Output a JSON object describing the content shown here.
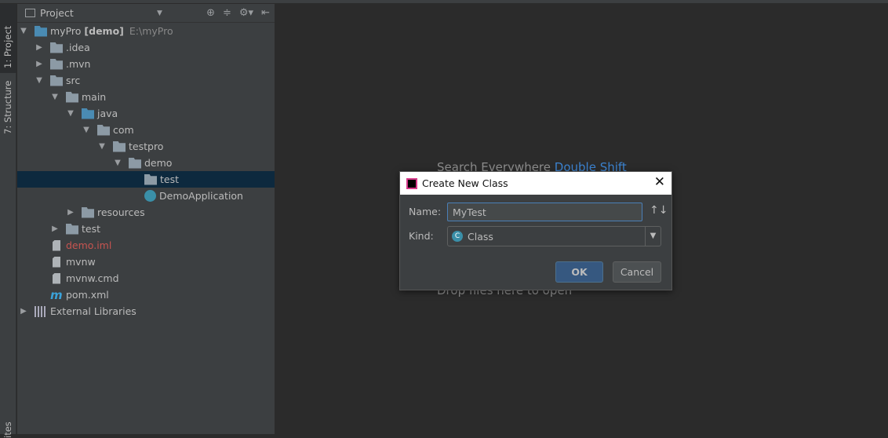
{
  "sidebar": {
    "tabs": [
      {
        "label": "1: Project"
      },
      {
        "label": "7: Structure"
      },
      {
        "label": "ites"
      }
    ]
  },
  "project_panel": {
    "title": "Project",
    "header_icons": [
      "locate-icon",
      "collapse-all-icon",
      "gear-icon",
      "hide-icon"
    ],
    "tree": [
      {
        "label": "myPro",
        "module": "[demo]",
        "path": "E:\\myPro",
        "level": 0,
        "expanded": true,
        "icon": "module-folder"
      },
      {
        "label": ".idea",
        "level": 1,
        "expanded": false,
        "icon": "folder"
      },
      {
        "label": ".mvn",
        "level": 1,
        "expanded": false,
        "icon": "folder"
      },
      {
        "label": "src",
        "level": 1,
        "expanded": true,
        "icon": "folder"
      },
      {
        "label": "main",
        "level": 2,
        "expanded": true,
        "icon": "folder"
      },
      {
        "label": "java",
        "level": 3,
        "expanded": true,
        "icon": "source-folder"
      },
      {
        "label": "com",
        "level": 4,
        "expanded": true,
        "icon": "package"
      },
      {
        "label": "testpro",
        "level": 5,
        "expanded": true,
        "icon": "package"
      },
      {
        "label": "demo",
        "level": 6,
        "expanded": true,
        "icon": "package"
      },
      {
        "label": "test",
        "level": 7,
        "icon": "package",
        "selected": true
      },
      {
        "label": "DemoApplication",
        "level": 7,
        "icon": "spring-class"
      },
      {
        "label": "resources",
        "level": 3,
        "expanded": false,
        "icon": "resources-folder"
      },
      {
        "label": "test",
        "level": 2,
        "expanded": false,
        "icon": "folder"
      },
      {
        "label": "demo.iml",
        "level": 1,
        "icon": "iml-file",
        "color": "#c75450"
      },
      {
        "label": "mvnw",
        "level": 1,
        "icon": "text-file"
      },
      {
        "label": "mvnw.cmd",
        "level": 1,
        "icon": "text-file"
      },
      {
        "label": "pom.xml",
        "level": 1,
        "icon": "maven"
      },
      {
        "label": "External Libraries",
        "level": 0,
        "expanded": false,
        "icon": "libraries"
      }
    ]
  },
  "editor": {
    "hint_search": "Search Everywhere",
    "hint_search_key": "Double Shift",
    "hint_drop": "Drop files here to open"
  },
  "dialog": {
    "title": "Create New Class",
    "name_label": "Name:",
    "name_value": "MyTest",
    "kind_label": "Kind:",
    "kind_value": "Class",
    "kind_icon_letter": "C",
    "ok": "OK",
    "cancel": "Cancel"
  },
  "colors": {
    "selection": "#0d293e",
    "accent": "#3c83d0",
    "error_file": "#c75450"
  }
}
